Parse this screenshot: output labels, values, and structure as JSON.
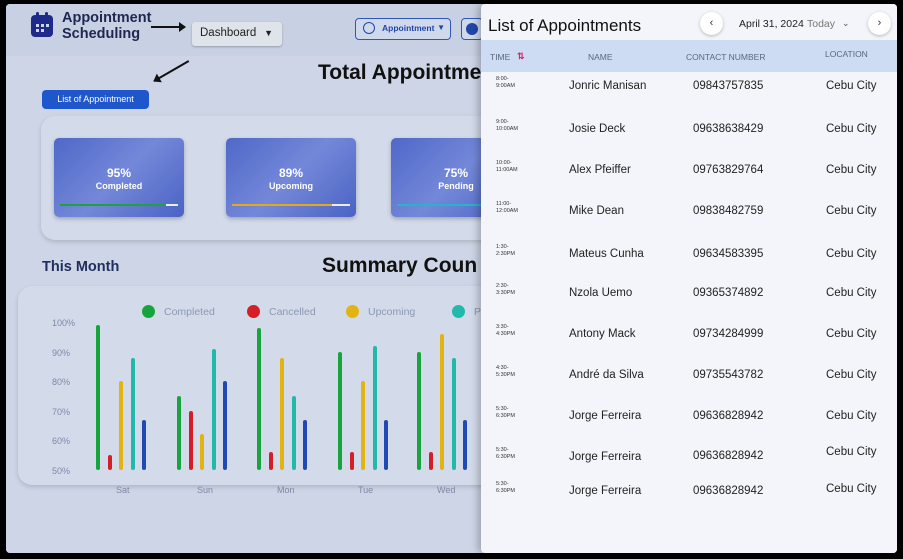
{
  "header": {
    "app_title": "Appointment Scheduling",
    "dashboard_select": "Dashboard",
    "appointment_button": "Appointment"
  },
  "main": {
    "total_title": "Total Appointme",
    "list_button": "List of Appointment",
    "cards": [
      {
        "percent": "95%",
        "label": "Completed",
        "color": "#1fa23a",
        "progress": 0.9
      },
      {
        "percent": "89%",
        "label": "Upcoming",
        "color": "#e0a920",
        "progress": 0.85
      },
      {
        "percent": "75%",
        "label": "Pending",
        "color": "#23b6c8",
        "progress": 0.75
      }
    ],
    "month_label": "This Month",
    "summary_title": "Summary Coun"
  },
  "chart_data": {
    "type": "bar",
    "legend": [
      {
        "name": "Completed",
        "color": "#16a53c"
      },
      {
        "name": "Cancelled",
        "color": "#d41f26"
      },
      {
        "name": "Upcoming",
        "color": "#e3b312"
      },
      {
        "name": "Pe",
        "color": "#22b8ab"
      }
    ],
    "y_ticks": [
      "100%",
      "90%",
      "80%",
      "70%",
      "60%",
      "50%"
    ],
    "ylim": [
      50,
      100
    ],
    "categories": [
      "Sat",
      "Sun",
      "Mon",
      "Tue",
      "Wed"
    ],
    "series": [
      {
        "name": "Completed",
        "color": "#16a53c",
        "values": [
          99,
          75,
          98,
          90,
          90
        ]
      },
      {
        "name": "Cancelled",
        "color": "#d41f26",
        "values": [
          55,
          70,
          56,
          56,
          56
        ]
      },
      {
        "name": "Upcoming",
        "color": "#e3b312",
        "values": [
          80,
          62,
          88,
          80,
          96
        ]
      },
      {
        "name": "Pe",
        "color": "#22b8ab",
        "values": [
          88,
          91,
          75,
          92,
          88
        ]
      },
      {
        "name": "",
        "color": "#2049b3",
        "values": [
          67,
          80,
          67,
          67,
          67
        ]
      }
    ]
  },
  "side_panel": {
    "title": "List of Appointments",
    "date": "April 31, 2024",
    "today": "Today",
    "prev_icon": "‹",
    "next_icon": "›",
    "columns": {
      "time": "TIME",
      "name": "NAME",
      "contact": "CONTACT NUMBER",
      "location": "LOCATION"
    },
    "rows": [
      {
        "time": "8:00-\n9:00AM",
        "name": "Jonric Manisan",
        "contact": "09843757835",
        "location": "Cebu City"
      },
      {
        "time": "9:00-\n10:00AM",
        "name": "Josie Deck",
        "contact": "09638638429",
        "location": "Cebu City"
      },
      {
        "time": "10:00-\n11:00AM",
        "name": "Alex Pfeiffer",
        "contact": "09763829764",
        "location": "Cebu City"
      },
      {
        "time": "11:00-\n12:00AM",
        "name": "Mike Dean",
        "contact": "09838482759",
        "location": "Cebu City"
      },
      {
        "time": "1:30-\n2:30PM",
        "name": "Mateus Cunha",
        "contact": "09634583395",
        "location": "Cebu City"
      },
      {
        "time": "2:30-\n3:30PM",
        "name": "Nzola Uemo",
        "contact": "09365374892",
        "location": "Cebu City"
      },
      {
        "time": "3:30-\n4:30PM",
        "name": "Antony Mack",
        "contact": "09734284999",
        "location": "Cebu City"
      },
      {
        "time": "4:30-\n5:30PM",
        "name": "André da Silva",
        "contact": "09735543782",
        "location": "Cebu City"
      },
      {
        "time": "5:30-\n6:30PM",
        "name": "Jorge Ferreira",
        "contact": "09636828942",
        "location": "Cebu City"
      },
      {
        "time": "5:30-\n6:30PM",
        "name": "Jorge Ferreira",
        "contact": "09636828942",
        "location": "Cebu City"
      },
      {
        "time": "5:30-\n6:30PM",
        "name": "Jorge Ferreira",
        "contact": "09636828942",
        "location": "Cebu City"
      }
    ]
  }
}
